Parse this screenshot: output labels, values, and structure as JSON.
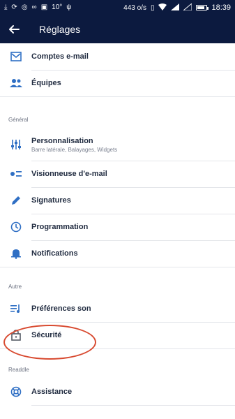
{
  "status_bar": {
    "temperature": "10°",
    "network_speed": "443 o/s",
    "time": "18:39",
    "battery_level": 0.85
  },
  "app_bar": {
    "back_icon": "arrow-left-icon",
    "title": "Réglages"
  },
  "menu": {
    "account_items": [
      {
        "icon": "envelope-icon",
        "label": "Comptes e-mail"
      },
      {
        "icon": "team-icon",
        "label": "Équipes"
      }
    ],
    "general_header": "Général",
    "general_items": [
      {
        "icon": "sliders-icon",
        "label": "Personnalisation",
        "sublabel": "Barre latérale, Balayages, Widgets"
      },
      {
        "icon": "email-viewer-icon",
        "label": "Visionneuse d'e-mail"
      },
      {
        "icon": "pencil-icon",
        "label": "Signatures"
      },
      {
        "icon": "clock-icon",
        "label": "Programmation"
      },
      {
        "icon": "bell-icon",
        "label": "Notifications"
      }
    ],
    "other_header": "Autre",
    "other_items": [
      {
        "icon": "sound-list-icon",
        "label": "Préférences son"
      },
      {
        "icon": "lock-icon",
        "label": "Sécurité"
      }
    ],
    "readdle_header": "Readdle",
    "readdle_items": [
      {
        "icon": "lifebuoy-icon",
        "label": "Assistance"
      }
    ]
  },
  "colors": {
    "app_bar": "#0c1a3f",
    "icon_blue": "#2f6fc4",
    "text_primary": "#1f2a3f",
    "annotation": "#d84a30"
  }
}
